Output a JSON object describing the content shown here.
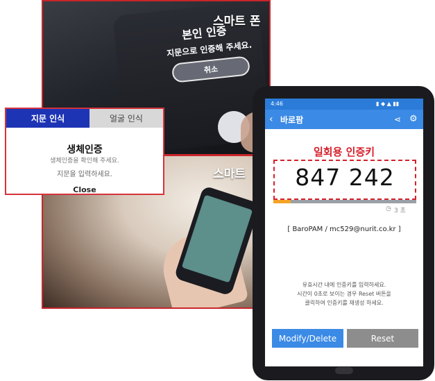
{
  "left_panel": {
    "caption_smartphone": "스마트 폰",
    "caption_smart2": "스마트",
    "phone_dialog": {
      "title": "본인 인증",
      "message": "지문으로 인증해 주세요.",
      "cancel": "취소"
    }
  },
  "biometric_popup": {
    "tab_fingerprint": "지문 인식",
    "tab_face": "얼굴 인식",
    "title": "생체인증",
    "subtitle": "생체인증을 확인해 주세요.",
    "prompt": "지문을 입력하세요.",
    "close": "Close",
    "accent_color": "#1d34b5"
  },
  "app": {
    "status_time": "4:46",
    "title": "바로팜",
    "otp_heading": "일회용 인증키",
    "otp_code": "847 242",
    "progress_fraction": 0.12,
    "timer_label": "3 초",
    "account": "[ BaroPAM / mc529@nurit.co.kr ]",
    "help_lines": [
      "유효시간 내에 인증키를 입력하세요.",
      "시간이 0초로 보이는 경우 Reset 버튼을",
      "클릭하여 인증키를 재생성 하세요."
    ],
    "btn_modify": "Modify/Delete",
    "btn_reset": "Reset",
    "accent_color": "#3a8ae6",
    "otp_color": "#d6202b"
  }
}
